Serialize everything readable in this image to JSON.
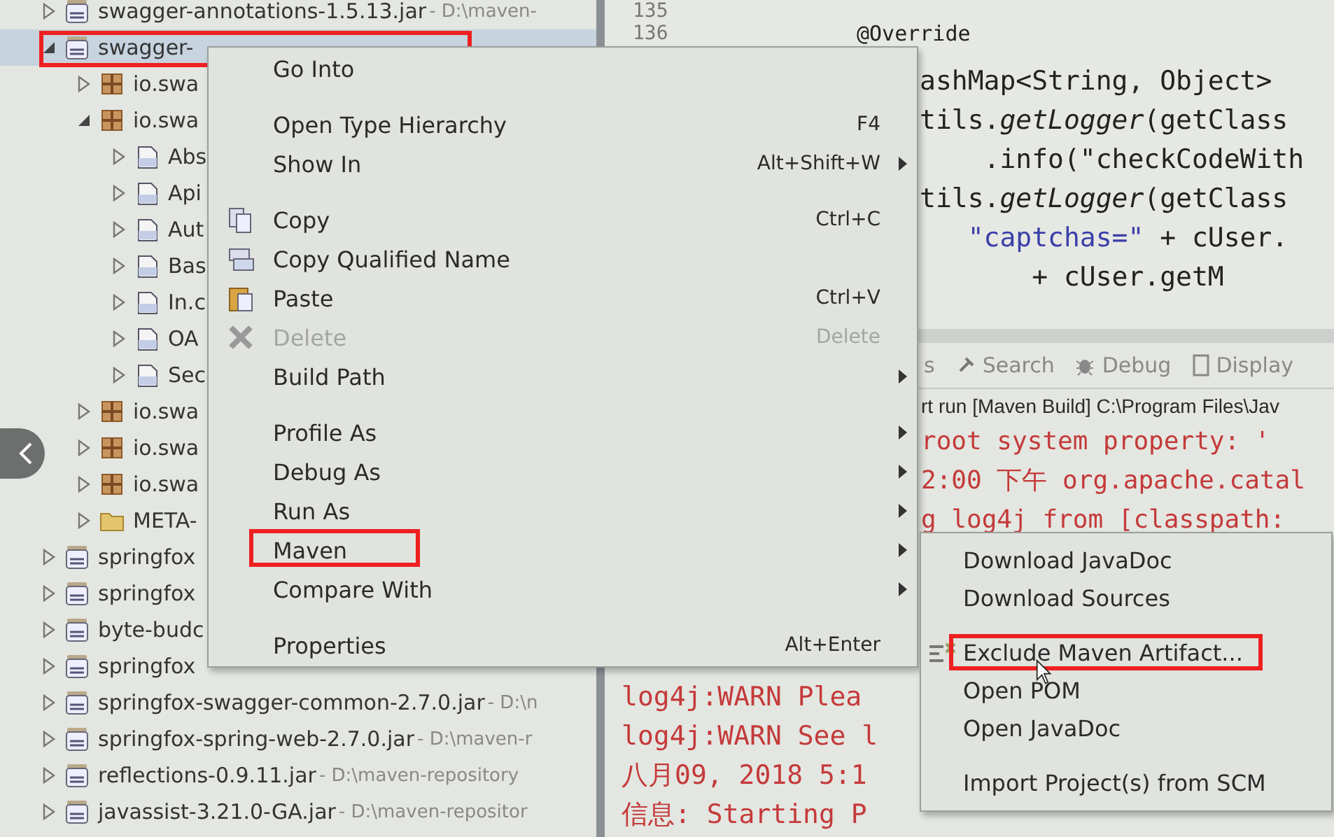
{
  "tree": {
    "items": [
      {
        "kind": "jar",
        "name": "swagger-annotations-1.5.13.jar",
        "path": " - D:\\maven-",
        "expanded": false,
        "selected": false,
        "annotated": false
      },
      {
        "kind": "jar",
        "name": "swagger-",
        "expanded": true,
        "selected": true,
        "annotated": true,
        "children": [
          {
            "kind": "package",
            "name": "io.swa",
            "expanded": false,
            "selected": false,
            "annotated": false
          },
          {
            "kind": "package",
            "name": "io.swa",
            "expanded": true,
            "selected": false,
            "annotated": false,
            "children": [
              {
                "kind": "class",
                "name": "Abs",
                "expanded": false,
                "selected": false,
                "annotated": false
              },
              {
                "kind": "class",
                "name": "Api",
                "expanded": false,
                "selected": false,
                "annotated": false
              },
              {
                "kind": "class",
                "name": "Aut",
                "expanded": false,
                "selected": false,
                "annotated": false
              },
              {
                "kind": "class",
                "name": "Bas",
                "expanded": false,
                "selected": false,
                "annotated": false
              },
              {
                "kind": "class",
                "name": "In.c",
                "expanded": false,
                "selected": false,
                "annotated": false
              },
              {
                "kind": "class",
                "name": "OA",
                "expanded": false,
                "selected": false,
                "annotated": false
              },
              {
                "kind": "class",
                "name": "Sec",
                "expanded": false,
                "selected": false,
                "annotated": false
              }
            ]
          },
          {
            "kind": "package",
            "name": "io.swa",
            "expanded": false,
            "selected": false,
            "annotated": false
          },
          {
            "kind": "package",
            "name": "io.swa",
            "expanded": false,
            "selected": false,
            "annotated": false
          },
          {
            "kind": "package",
            "name": "io.swa",
            "expanded": false,
            "selected": false,
            "annotated": false
          },
          {
            "kind": "folder",
            "name": "META-",
            "expanded": false,
            "selected": false,
            "annotated": false
          }
        ]
      },
      {
        "kind": "jar",
        "name": "springfox",
        "expanded": false,
        "selected": false,
        "annotated": false
      },
      {
        "kind": "jar",
        "name": "springfox",
        "expanded": false,
        "selected": false,
        "annotated": false
      },
      {
        "kind": "jar",
        "name": "byte-budc",
        "expanded": false,
        "selected": false,
        "annotated": false
      },
      {
        "kind": "jar",
        "name": "springfox",
        "expanded": false,
        "selected": false,
        "annotated": false
      },
      {
        "kind": "jar",
        "name": "springfox-swagger-common-2.7.0.jar",
        "path": " - D:\\n",
        "expanded": false,
        "selected": false,
        "annotated": false
      },
      {
        "kind": "jar",
        "name": "springfox-spring-web-2.7.0.jar",
        "path": " - D:\\maven-r",
        "expanded": false,
        "selected": false,
        "annotated": false
      },
      {
        "kind": "jar",
        "name": "reflections-0.9.11.jar",
        "path": " - D:\\maven-repository",
        "expanded": false,
        "selected": false,
        "annotated": false
      },
      {
        "kind": "jar",
        "name": "javassist-3.21.0-GA.jar",
        "path": " - D:\\maven-repositor",
        "expanded": false,
        "selected": false,
        "annotated": false
      }
    ]
  },
  "editor": {
    "lines": [
      {
        "number": "135"
      },
      {
        "number": "136",
        "code": "@Override"
      },
      {
        "code": "ashMap<String, Object>"
      },
      {
        "code": "tils.*getLogger*(getClass"
      },
      {
        "code": "    .info(\"checkCodeWith"
      },
      {
        "code": "tils.*getLogger*(getClass"
      },
      {
        "code": "   \"captchas=\" + cUser."
      },
      {
        "code": "       + cUser.getM"
      }
    ]
  },
  "console": {
    "tabs": [
      {
        "label": "s"
      },
      {
        "label": "Search"
      },
      {
        "label": "Debug"
      },
      {
        "label": "Display"
      }
    ],
    "header": "rt run [Maven Build] C:\\Program Files\\Jav",
    "lines": [
      {
        "text": "root system property: '",
        "covered": true
      },
      {
        "text": "2:00 下午 org.apache.catal",
        "covered": true
      },
      {
        "text": "g log4j from [classpath:",
        "covered": true
      },
      {
        "text": "log4j:WARN Plea",
        "covered": false
      },
      {
        "text": "log4j:WARN See l",
        "covered": false
      },
      {
        "text": "八月09, 2018 5:1",
        "covered": false
      },
      {
        "text": "信息: Starting P",
        "covered": false
      }
    ]
  },
  "context_menu": {
    "items": [
      {
        "kind": "item",
        "label": "Go Into",
        "disabled": false,
        "submenu": false,
        "annotated": false
      },
      {
        "kind": "separator"
      },
      {
        "kind": "item",
        "label": "Open Type Hierarchy",
        "shortcut": "F4",
        "disabled": false,
        "submenu": false,
        "annotated": false
      },
      {
        "kind": "item",
        "label": "Show In",
        "shortcut": "Alt+Shift+W",
        "disabled": false,
        "submenu": true,
        "annotated": false
      },
      {
        "kind": "separator"
      },
      {
        "kind": "item",
        "label": "Copy",
        "shortcut": "Ctrl+C",
        "disabled": false,
        "submenu": false,
        "annotated": false
      },
      {
        "kind": "item",
        "label": "Copy Qualified Name",
        "disabled": false,
        "submenu": false,
        "annotated": false
      },
      {
        "kind": "item",
        "label": "Paste",
        "shortcut": "Ctrl+V",
        "disabled": false,
        "submenu": false,
        "annotated": false
      },
      {
        "kind": "item",
        "label": "Delete",
        "shortcut": "Delete",
        "disabled": true,
        "submenu": false,
        "annotated": false
      },
      {
        "kind": "item",
        "label": "Build Path",
        "disabled": false,
        "submenu": true,
        "annotated": false
      },
      {
        "kind": "separator"
      },
      {
        "kind": "item",
        "label": "Profile As",
        "disabled": false,
        "submenu": true,
        "annotated": false
      },
      {
        "kind": "item",
        "label": "Debug As",
        "disabled": false,
        "submenu": true,
        "annotated": false
      },
      {
        "kind": "item",
        "label": "Run As",
        "disabled": false,
        "submenu": true,
        "annotated": false
      },
      {
        "kind": "item",
        "label": "Maven",
        "disabled": false,
        "submenu": true,
        "annotated": true
      },
      {
        "kind": "item",
        "label": "Compare With",
        "disabled": false,
        "submenu": true,
        "annotated": false
      },
      {
        "kind": "separator"
      },
      {
        "kind": "item",
        "label": "Properties",
        "shortcut": "Alt+Enter",
        "disabled": false,
        "submenu": false,
        "annotated": false
      }
    ]
  },
  "submenu": {
    "items": [
      {
        "kind": "item",
        "label": "Download JavaDoc",
        "annotated": false
      },
      {
        "kind": "item",
        "label": "Download Sources",
        "annotated": false
      },
      {
        "kind": "separator"
      },
      {
        "kind": "item",
        "label": "Exclude Maven Artifact...",
        "annotated": true,
        "hovered": true
      },
      {
        "kind": "item",
        "label": "Open POM",
        "annotated": false
      },
      {
        "kind": "item",
        "label": "Open JavaDoc",
        "annotated": false
      },
      {
        "kind": "separator"
      },
      {
        "kind": "item",
        "label": "Import Project(s) from SCM",
        "annotated": false
      }
    ]
  }
}
